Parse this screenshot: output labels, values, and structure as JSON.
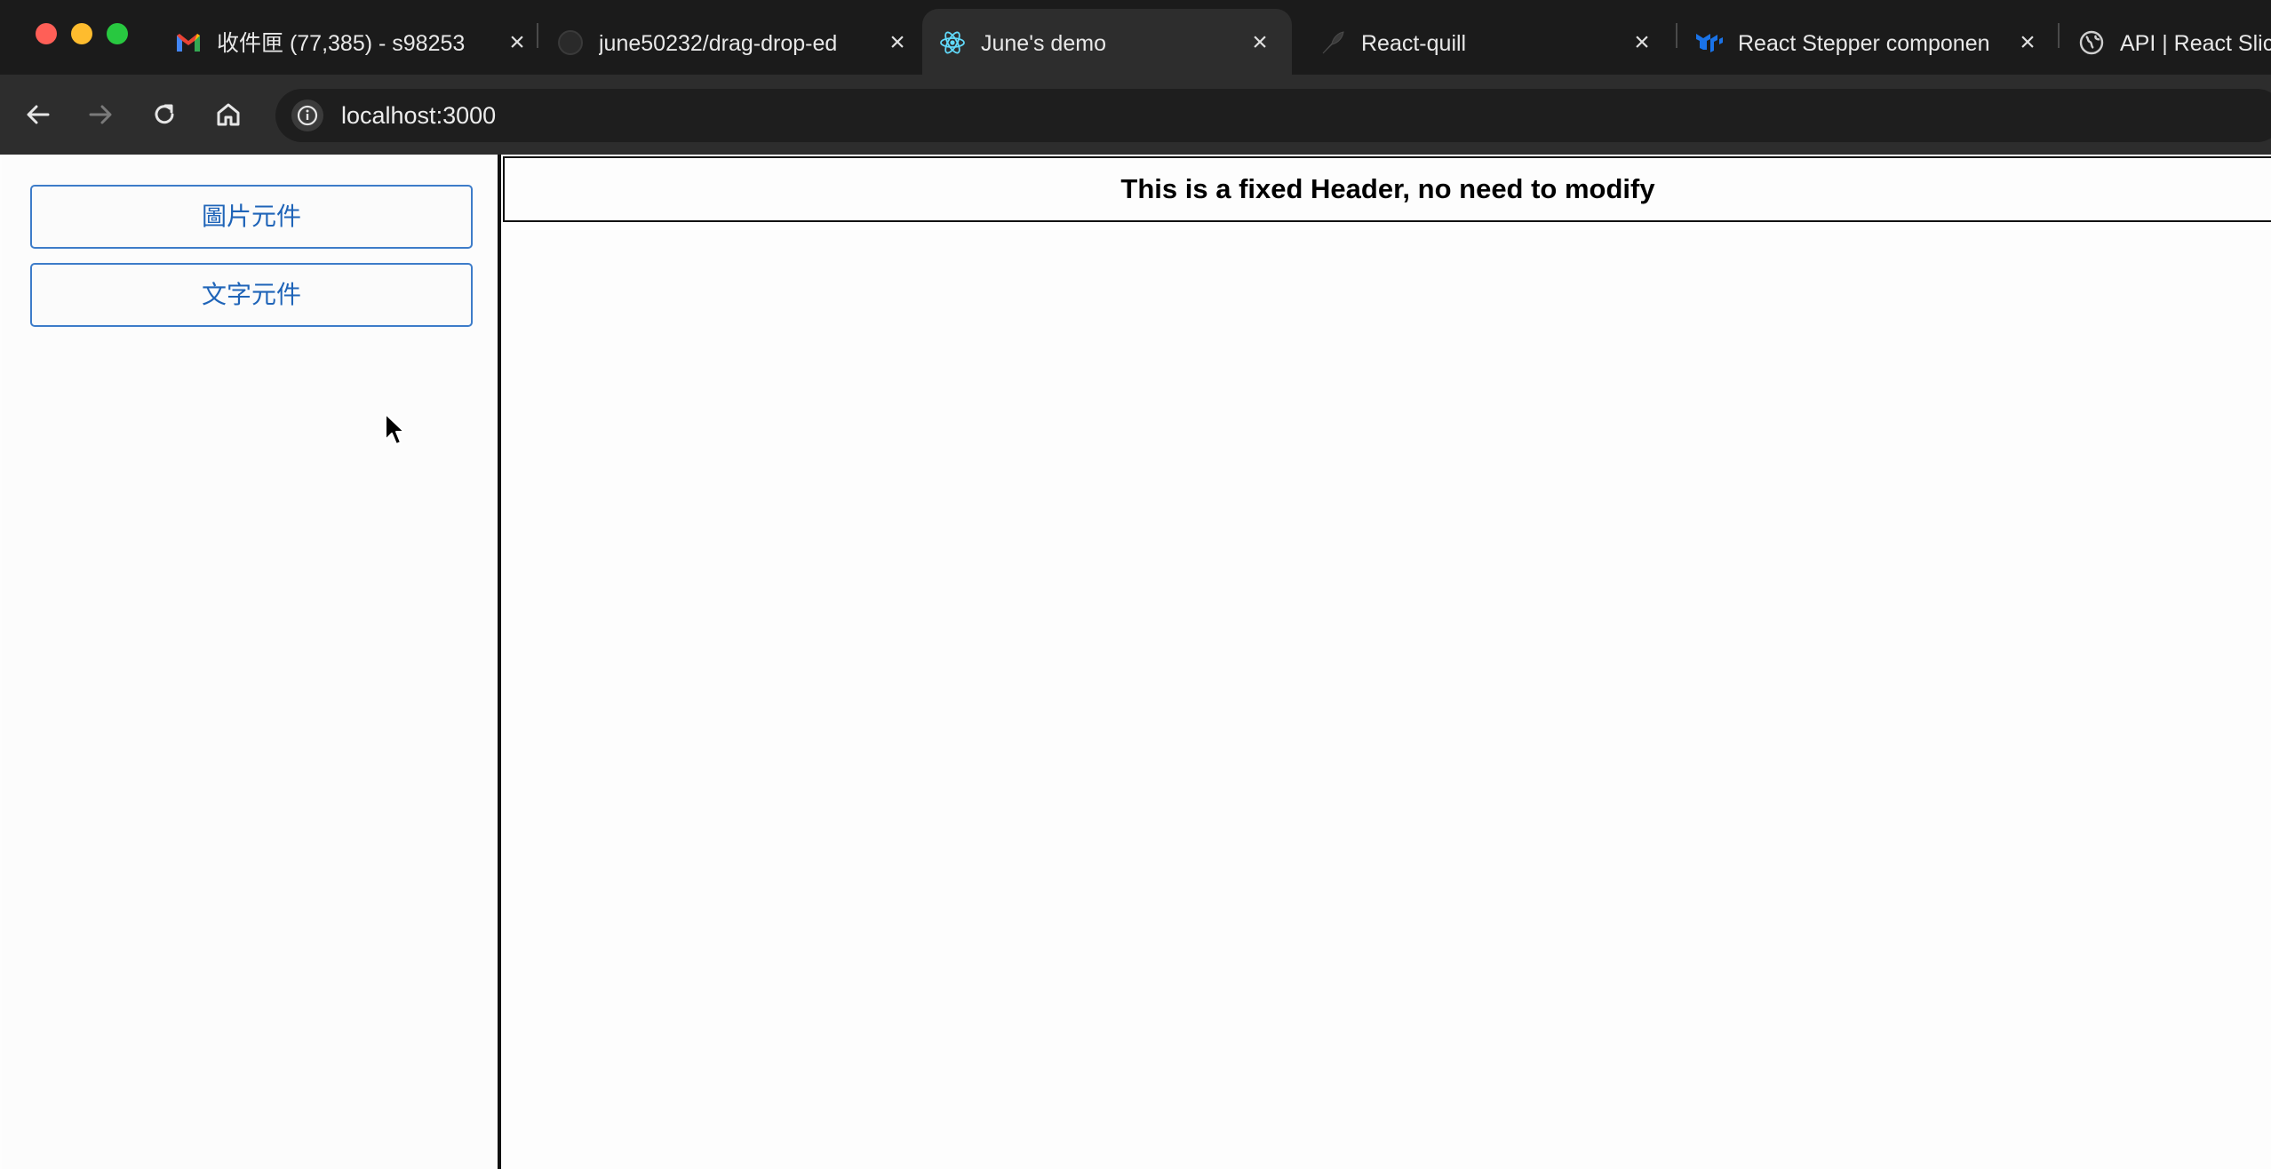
{
  "window": {
    "traffic_lights": [
      "close",
      "minimize",
      "zoom"
    ]
  },
  "tabs": [
    {
      "label": "收件匣 (77,385) - s98253",
      "icon": "gmail-icon",
      "active": false
    },
    {
      "label": "june50232/drag-drop-ed",
      "icon": "github-icon",
      "active": false
    },
    {
      "label": "June's demo",
      "icon": "react-icon",
      "active": true
    },
    {
      "label": "React-quill",
      "icon": "feather-icon",
      "active": false
    },
    {
      "label": "React Stepper componen",
      "icon": "mui-icon",
      "active": false
    },
    {
      "label": "API | React Slic",
      "icon": "globe-icon",
      "active": false
    }
  ],
  "toolbar": {
    "url": "localhost:3000"
  },
  "sidebar": {
    "buttons": [
      {
        "label": "圖片元件"
      },
      {
        "label": "文字元件"
      }
    ]
  },
  "main": {
    "header_text": "This is a fixed Header, no need to modify"
  },
  "colors": {
    "accent": "#1f64b8",
    "button_border": "#3d7cc9",
    "tab_strip": "#1b1b1b",
    "toolbar": "#2d2d2d"
  }
}
